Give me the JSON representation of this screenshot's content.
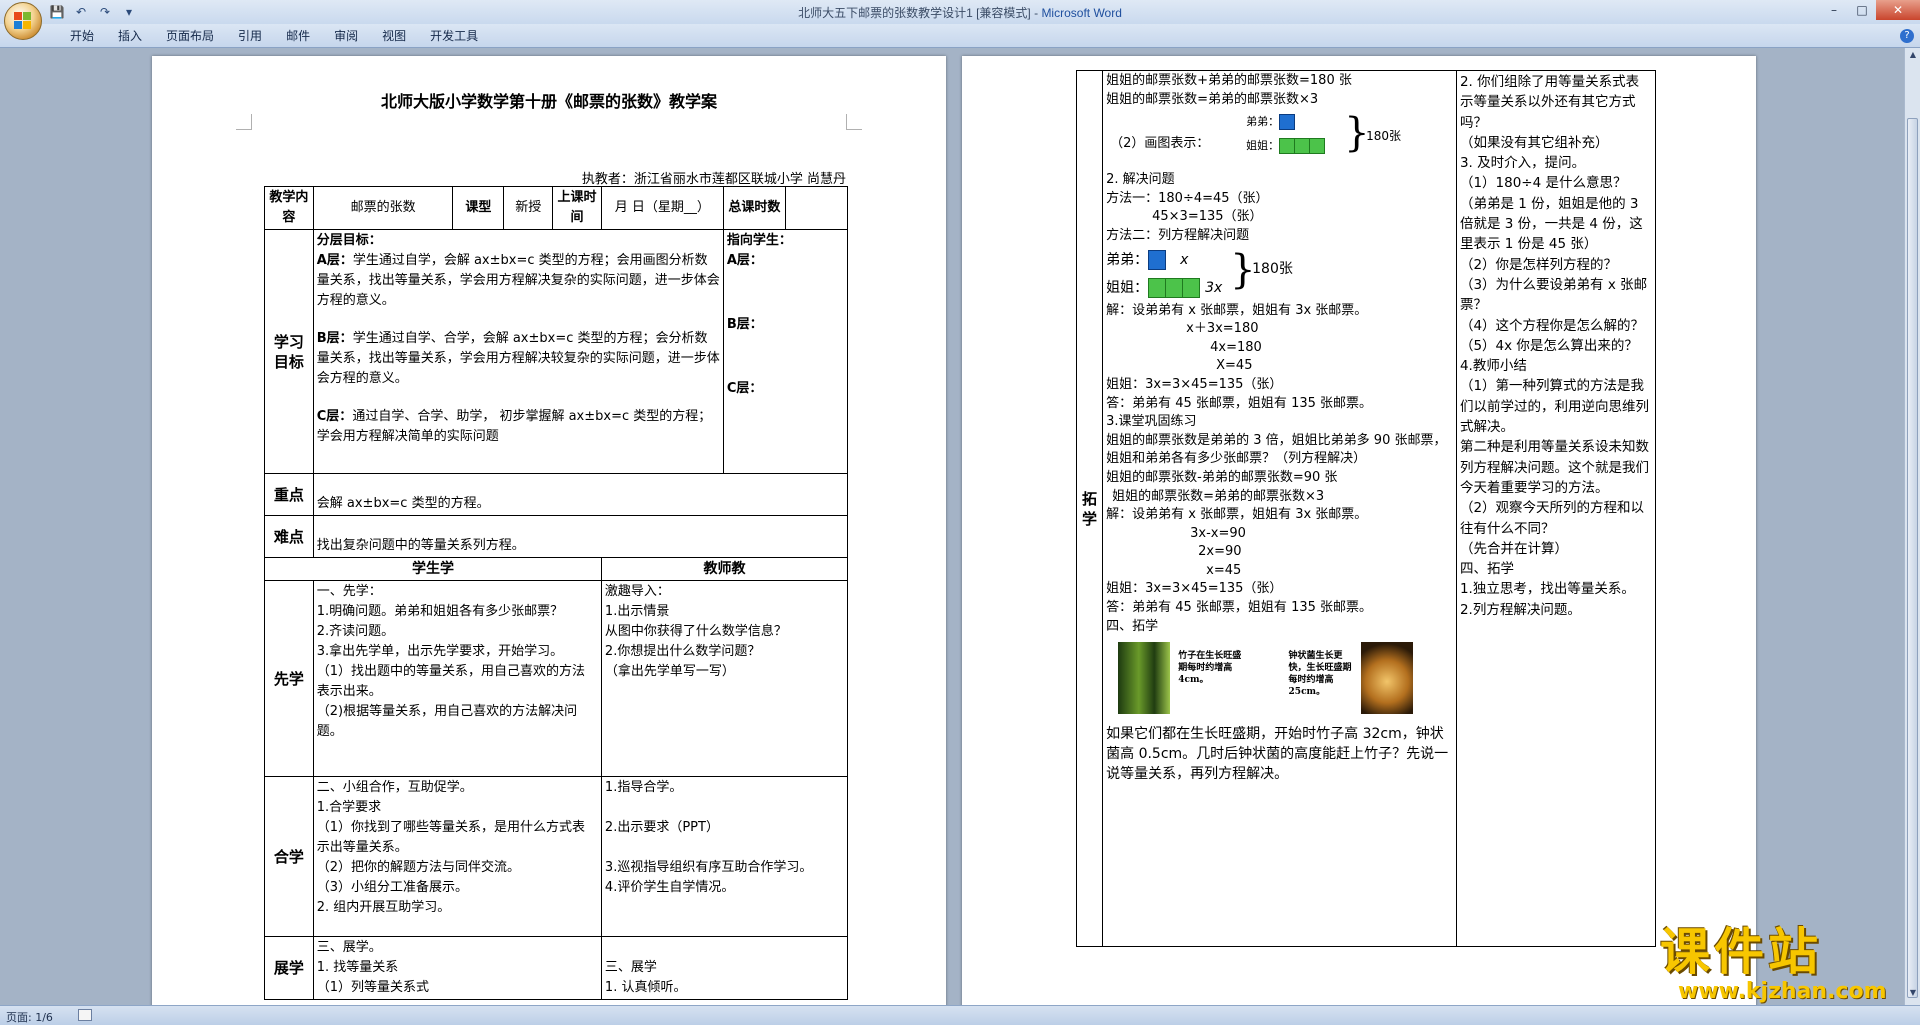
{
  "window": {
    "title": "北师大五下邮票的张数教学设计1 [兼容模式] - ",
    "app_name": "Microsoft Word"
  },
  "qat": {
    "save": "💾",
    "undo": "↶",
    "redo": "↷",
    "more": "▾"
  },
  "ribbon": {
    "tabs": [
      "开始",
      "插入",
      "页面布局",
      "引用",
      "邮件",
      "审阅",
      "视图",
      "开发工具"
    ],
    "help": "?"
  },
  "page1": {
    "title": "北师大版小学数学第十册《邮票的张数》教学案",
    "author": "执教者：浙江省丽水市莲都区联城小学 尚慧丹",
    "header_row": {
      "c1": "教学内容",
      "c2": "邮票的张数",
      "c3": "课型",
      "c4": "新授",
      "c5": "上课时间",
      "c6": "月  日（星期__）",
      "c7": "总课时数"
    },
    "goals": {
      "label": "学习目标",
      "left_title": "分层目标：",
      "a_head": "A层：",
      "a_text": "学生通过自学，会解 ax±bx=c 类型的方程；会用画图分析数量关系，找出等量关系，学会用方程解决复杂的实际问题，进一步体会方程的意义。",
      "b_head": "B层：",
      "b_text": "学生通过自学、合学，会解 ax±bx=c 类型的方程；会分析数量关系，找出等量关系，学会用方程解决较复杂的实际问题，进一步体会方程的意义。",
      "c_head": "C层：",
      "c_text": "通过自学、合学、助学， 初步掌握解 ax±bx=c 类型的方程；学会用方程解决简单的实际问题",
      "right_title": "指向学生：",
      "ra": "A层：",
      "rb": "B层：",
      "rc": "C层："
    },
    "key": {
      "label": "重点",
      "text": "会解 ax±bx=c 类型的方程。"
    },
    "difficult": {
      "label": "难点",
      "text": "找出复杂问题中的等量关系列方程。"
    },
    "section_headers": {
      "student": "学生学",
      "teacher": "教师教"
    },
    "xianxue": {
      "label": "先学",
      "student": [
        "一、先学：",
        "1.明确问题。弟弟和姐姐各有多少张邮票？",
        "2.齐读问题。",
        "3.拿出先学单，出示先学要求，开始学习。",
        "（1）找出题中的等量关系，用自己喜欢的方法表示出来。",
        "（2)根据等量关系，用自己喜欢的方法解决问题。"
      ],
      "teacher": [
        "激趣导入：",
        "1.出示情景",
        "从图中你获得了什么数学信息？",
        "2.你想提出什么数学问题？",
        "（拿出先学单写一写）"
      ]
    },
    "hexue": {
      "label": "合学",
      "student": [
        "二、小组合作，互助促学。",
        "1.合学要求",
        "（1）你找到了哪些等量关系，是用什么方式表示出等量关系。",
        "（2）把你的解题方法与同伴交流。",
        "（3）小组分工准备展示。",
        "2. 组内开展互助学习。"
      ],
      "teacher": [
        "1.指导合学。",
        "2.出示要求（PPT）",
        "3.巡视指导组织有序互助合作学习。",
        "4.评价学生自学情况。"
      ]
    },
    "zhanxue": {
      "label": "展学",
      "student": [
        "三、展学。",
        "1. 找等量关系",
        "（1）列等量关系式"
      ],
      "teacher": [
        "三、展学",
        "1. 认真倾听。"
      ]
    }
  },
  "page2": {
    "left_label": "拓学",
    "student_top": [
      "姐姐的邮票张数+弟弟的邮票张数=180 张",
      "姐姐的邮票张数=弟弟的邮票张数×3"
    ],
    "diagram1": {
      "caption": "（2）画图表示：",
      "brother": "弟弟：",
      "sister": "姐姐：",
      "total": "180张"
    },
    "solve": [
      "2. 解决问题",
      "方法一：180÷4=45（张）",
      "45×3=135（张）",
      "方法二：列方程解决问题"
    ],
    "diagram2": {
      "brother": "弟弟：",
      "sister": "姐姐：",
      "x": "x",
      "x3": "3x",
      "total": "180张"
    },
    "equation": [
      "解：设弟弟有 x 张邮票，姐姐有 3x 张邮票。",
      "x＋3x=180",
      "4x=180",
      "X=45",
      "姐姐：3x=3×45=135（张）",
      "答：弟弟有 45 张邮票，姐姐有 135 张邮票。"
    ],
    "practice": [
      "3.课堂巩固练习",
      "姐姐的邮票张数是弟弟的 3 倍，姐姐比弟弟多 90 张邮票，姐姐和弟弟各有多少张邮票？（列方程解决）",
      "姐姐的邮票张数-弟弟的邮票张数=90 张",
      "姐姐的邮票张数=弟弟的邮票张数×3",
      "解：设弟弟有 x 张邮票，姐姐有 3x 张邮票。",
      "3x-x=90",
      "2x=90",
      "x=45",
      "姐姐：3x=3×45=135（张）",
      "答：弟弟有 45 张邮票，姐姐有 135 张邮票。",
      "四、拓学"
    ],
    "photo": {
      "bamboo_caption": "竹子在生长旺盛期每时约增高4cm。",
      "mushroom_caption": "钟状菌生长更快，生长旺盛期每时约增高25cm。"
    },
    "problem": "如果它们都在生长旺盛期，开始时竹子高 32cm，钟状菌高 0.5cm。几时后钟状菌的高度能赶上竹子？先说一说等量关系，再列方程解决。",
    "teacher": [
      "2. 你们组除了用等量关系式表示等量关系以外还有其它方式吗？",
      "（如果没有其它组补充）",
      "3. 及时介入，提问。",
      "（1）180÷4 是什么意思？",
      "（弟弟是 1 份，姐姐是他的 3 倍就是 3 份，一共是 4 份，这里表示 1 份是 45 张）",
      "（2）你是怎样列方程的？",
      "（3）为什么要设弟弟有 x 张邮票？",
      "（4）这个方程你是怎么解的？",
      "（5）4x 你是怎么算出来的？",
      "4.教师小结",
      "（1）第一种列算式的方法是我们以前学过的，利用逆向思维列式解决。",
      "第二种是利用等量关系设未知数列方程解决问题。这个就是我们今天着重要学习的方法。",
      "（2）观察今天所列的方程和以往有什么不同？",
      "（先合并在计算）",
      "四、拓学",
      "1.独立思考，找出等量关系。",
      "2.列方程解决问题。"
    ]
  },
  "status": {
    "page": "页面: 1/6"
  },
  "watermark": {
    "big": "课件站",
    "url": "www.kjzhan.com"
  }
}
